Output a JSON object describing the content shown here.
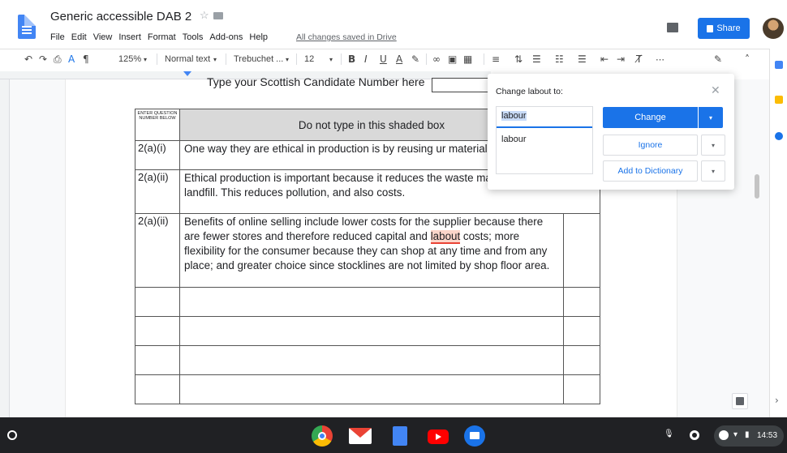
{
  "window": {
    "title": "Generic accessible DAB 2",
    "save_status": "All changes saved in Drive",
    "share_label": "Share"
  },
  "menu": [
    "File",
    "Edit",
    "View",
    "Insert",
    "Format",
    "Tools",
    "Add-ons",
    "Help"
  ],
  "toolbar": {
    "zoom": "125%",
    "style": "Normal text",
    "font": "Trebuchet ...",
    "font_size": "12",
    "more": "⋯"
  },
  "document": {
    "candidate_prompt": "Type your Scottish Candidate Number here",
    "table": {
      "header_question": "ENTER QUESTION NUMBER BELOW",
      "header_shaded": "Do not type in this shaded box",
      "rows": [
        {
          "q": "2(a)(i)",
          "a": "One way they are ethical in production is by reusing ur materials."
        },
        {
          "q": "2(a)(ii)",
          "a": "Ethical  production is important because it reduces the waste material that goes into landfill. This reduces pollution, and also costs."
        },
        {
          "q": "2(a)(ii)",
          "a_before": "Benefits of online selling include lower costs for the supplier because there are fewer stores and therefore reduced capital and ",
          "a_misspelled": "labout",
          "a_after": " costs; more flexibility for the consumer because they can shop at any time and from any place; and greater choice since stocklines are not limited by shop floor area."
        }
      ]
    }
  },
  "spellcheck": {
    "title": "Change labout to:",
    "input_value": "labour",
    "suggestion": "labour",
    "change_label": "Change",
    "ignore_label": "Ignore",
    "add_label": "Add to Dictionary"
  },
  "taskbar": {
    "time": "14:53"
  },
  "colors": {
    "accent": "#1a73e8",
    "taskbar": "#202124",
    "misspell_highlight": "#fbd5c9"
  }
}
